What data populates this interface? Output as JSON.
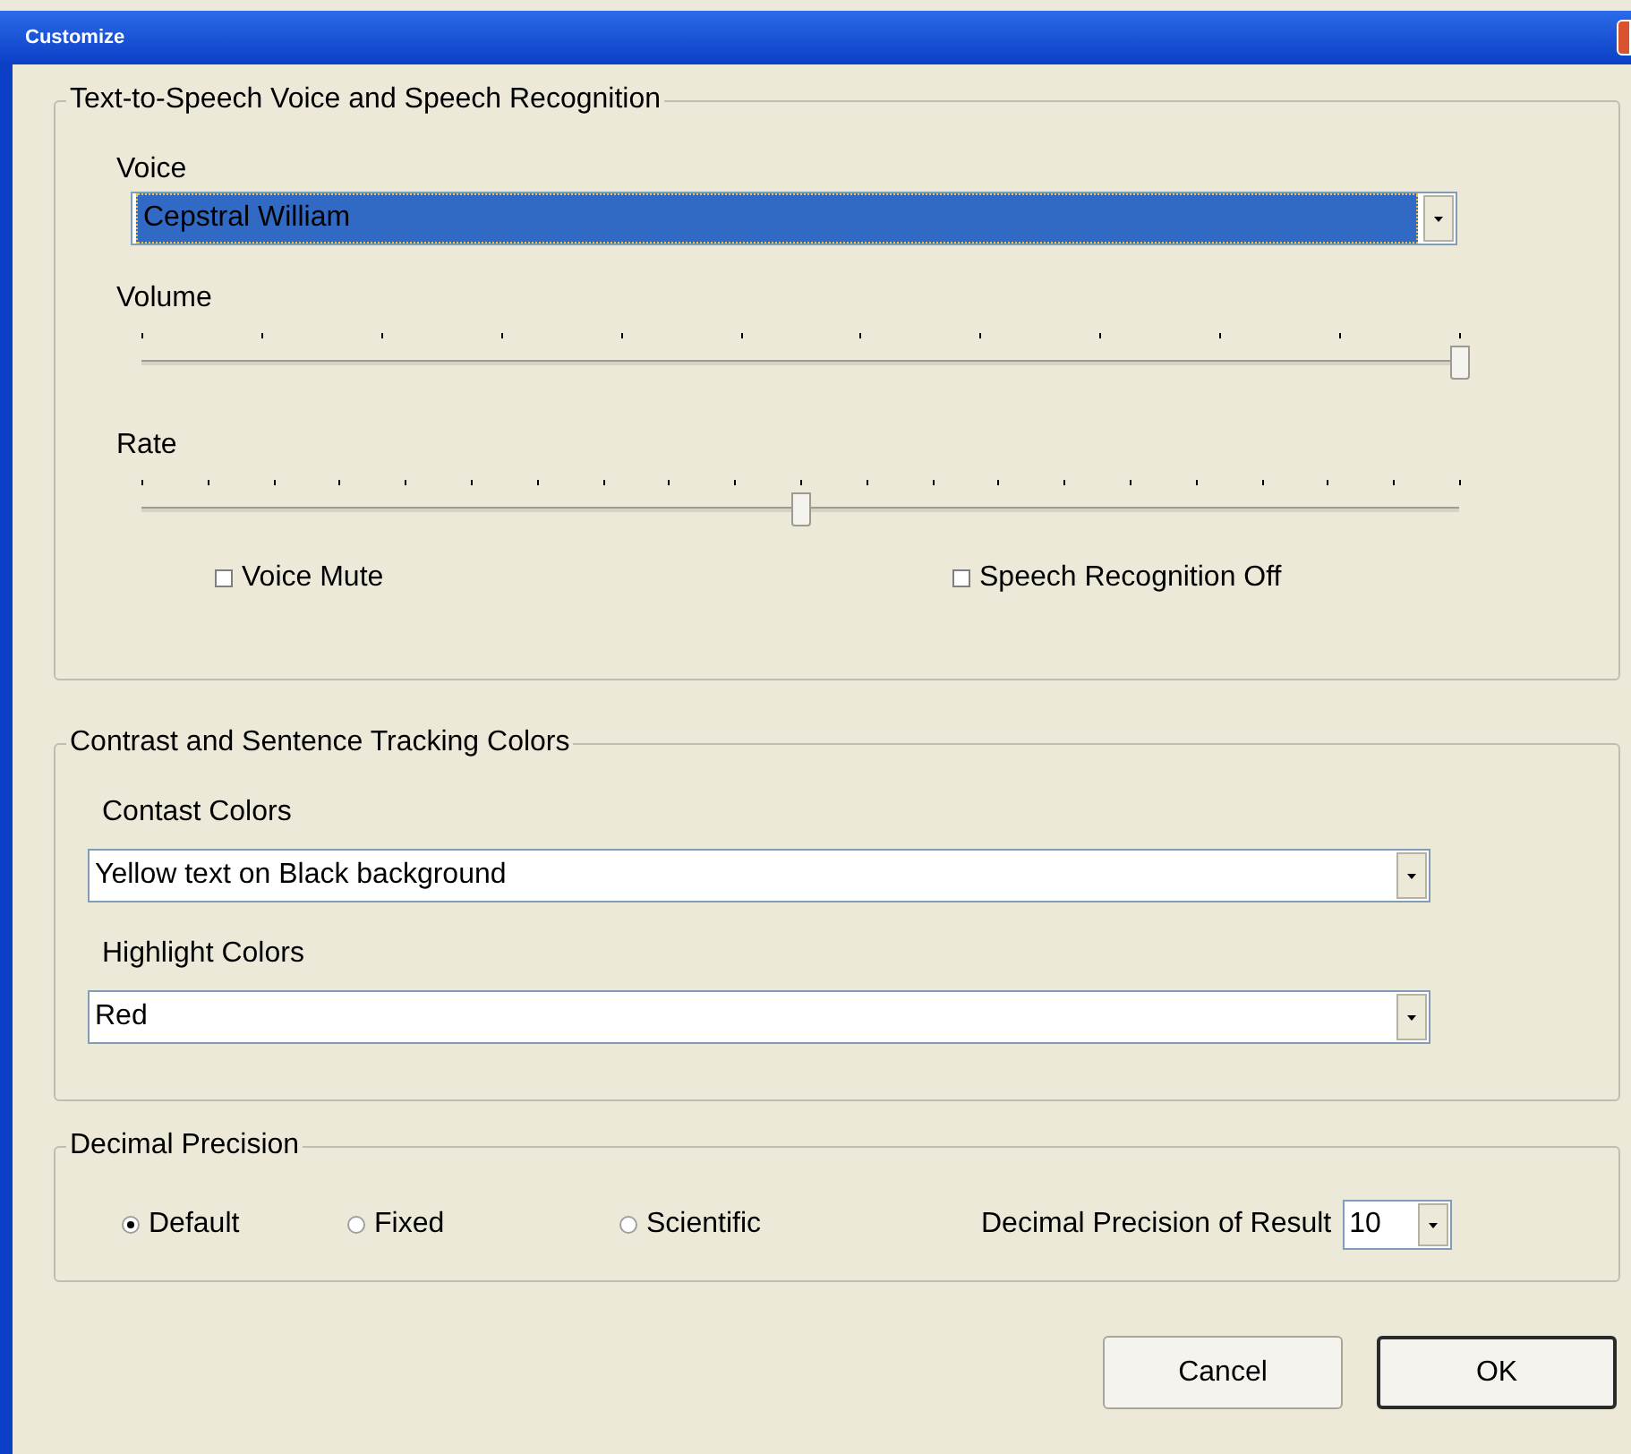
{
  "window": {
    "title": "Customize"
  },
  "speech": {
    "title": "Text-to-Speech Voice and Speech Recognition",
    "voice": {
      "label": "Voice",
      "value": "Cepstral William",
      "highlighted": true
    },
    "sliders": [
      {
        "label": "Volume",
        "level": 1
      },
      {
        "label": "Rate",
        "level": 0.5
      }
    ],
    "checkboxes": [
      {
        "label": "Voice Mute",
        "checked": false
      },
      {
        "label": "Speech Recognition Off",
        "checked": false
      }
    ]
  },
  "colors": {
    "title": "Contrast and Sentence Tracking Colors",
    "dropdowns": [
      {
        "label": "Contast Colors",
        "value": "Yellow text on Black background"
      },
      {
        "label": "Highlight Colors",
        "value": "Red"
      }
    ]
  },
  "precision": {
    "title": "Decimal Precision",
    "radios": [
      {
        "label": "Default",
        "selected": true
      },
      {
        "label": "Fixed",
        "selected": false
      },
      {
        "label": "Scientific",
        "selected": false
      }
    ],
    "result": {
      "label": "Decimal Precision of Result",
      "value": "10"
    }
  },
  "buttons": [
    {
      "label": "Cancel",
      "default": false
    },
    {
      "label": "OK",
      "default": true
    }
  ]
}
